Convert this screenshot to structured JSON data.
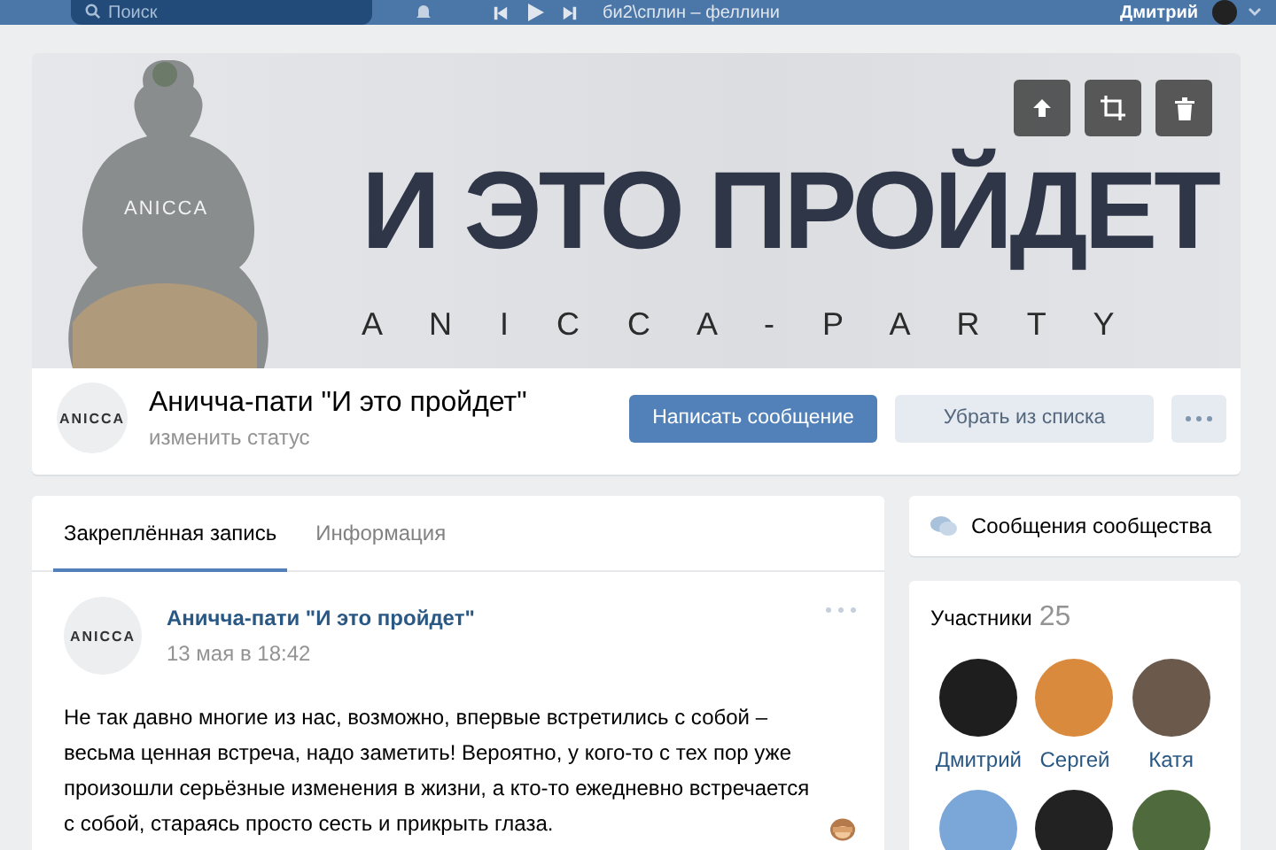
{
  "header": {
    "search": {
      "placeholder": "Поиск"
    },
    "track": "би2\\сплин – феллини",
    "user": "Дмитрий"
  },
  "cover": {
    "title": "И ЭТО ПРОЙДЕТ",
    "subtitle": "A N I C C A - P A R T Y",
    "figure_label": "ANICCA"
  },
  "group": {
    "avatar_text": "ANICCA",
    "name": "Аничча-пати \"И это пройдет\"",
    "status": "изменить статус",
    "buttons": [
      {
        "label": "Написать сообщение",
        "kind": "primary"
      },
      {
        "label": "Убрать из списка",
        "kind": "secondary"
      },
      {
        "kind": "more"
      }
    ]
  },
  "tabs": [
    {
      "label": "Закреплённая запись",
      "selected": true
    },
    {
      "label": "Информация",
      "selected": false
    }
  ],
  "post": {
    "avatar_text": "ANICCA",
    "author": "Аничча-пати \"И это пройдет\"",
    "date": "13 мая в 18:42",
    "text": "Не так давно многие из нас, возможно, впервые встретились с собой – весьма ценная встреча, надо заметить! Вероятно, у кого-то с тех пор уже произошли серьёзные изменения в жизни, а кто-то ежедневно встречается с собой, стараясь просто сесть и прикрыть глаза."
  },
  "sidebar": {
    "messages": "Сообщения сообщества",
    "members": {
      "title": "Участники",
      "count": "25",
      "people": [
        {
          "kind": "named",
          "name": "Дмитрий"
        },
        {
          "kind": "named",
          "name": "Сергей"
        },
        {
          "kind": "named",
          "name": "Катя"
        },
        {
          "kind": "unnamed"
        },
        {
          "kind": "unnamed"
        },
        {
          "kind": "unnamed"
        }
      ]
    }
  }
}
